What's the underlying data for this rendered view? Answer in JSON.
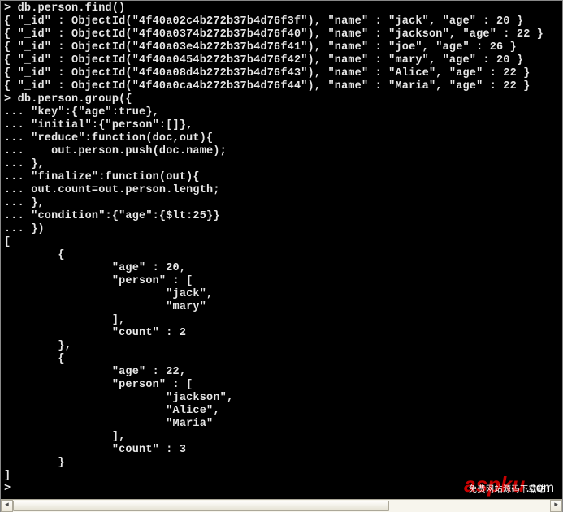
{
  "terminal": {
    "lines": [
      "> db.person.find()",
      "{ \"_id\" : ObjectId(\"4f40a02c4b272b37b4d76f3f\"), \"name\" : \"jack\", \"age\" : 20 }",
      "{ \"_id\" : ObjectId(\"4f40a0374b272b37b4d76f40\"), \"name\" : \"jackson\", \"age\" : 22 }",
      "{ \"_id\" : ObjectId(\"4f40a03e4b272b37b4d76f41\"), \"name\" : \"joe\", \"age\" : 26 }",
      "{ \"_id\" : ObjectId(\"4f40a0454b272b37b4d76f42\"), \"name\" : \"mary\", \"age\" : 20 }",
      "{ \"_id\" : ObjectId(\"4f40a08d4b272b37b4d76f43\"), \"name\" : \"Alice\", \"age\" : 22 }",
      "{ \"_id\" : ObjectId(\"4f40a0ca4b272b37b4d76f44\"), \"name\" : \"Maria\", \"age\" : 22 }",
      "> db.person.group({",
      "... \"key\":{\"age\":true},",
      "... \"initial\":{\"person\":[]},",
      "... \"reduce\":function(doc,out){",
      "...    out.person.push(doc.name);",
      "... },",
      "... \"finalize\":function(out){",
      "... out.count=out.person.length;",
      "... },",
      "... \"condition\":{\"age\":{$lt:25}}",
      "... })",
      "[",
      "        {",
      "                \"age\" : 20,",
      "                \"person\" : [",
      "                        \"jack\",",
      "                        \"mary\"",
      "                ],",
      "                \"count\" : 2",
      "        },",
      "        {",
      "                \"age\" : 22,",
      "                \"person\" : [",
      "                        \"jackson\",",
      "                        \"Alice\",",
      "                        \"Maria\"",
      "                ],",
      "                \"count\" : 3",
      "        }",
      "]",
      ">"
    ]
  },
  "watermark": {
    "brand_red": "aspku",
    "brand_white": ".com",
    "tagline": "免费网站源码下载站！"
  },
  "scrollbar": {
    "left_arrow": "◄",
    "right_arrow": "►"
  }
}
